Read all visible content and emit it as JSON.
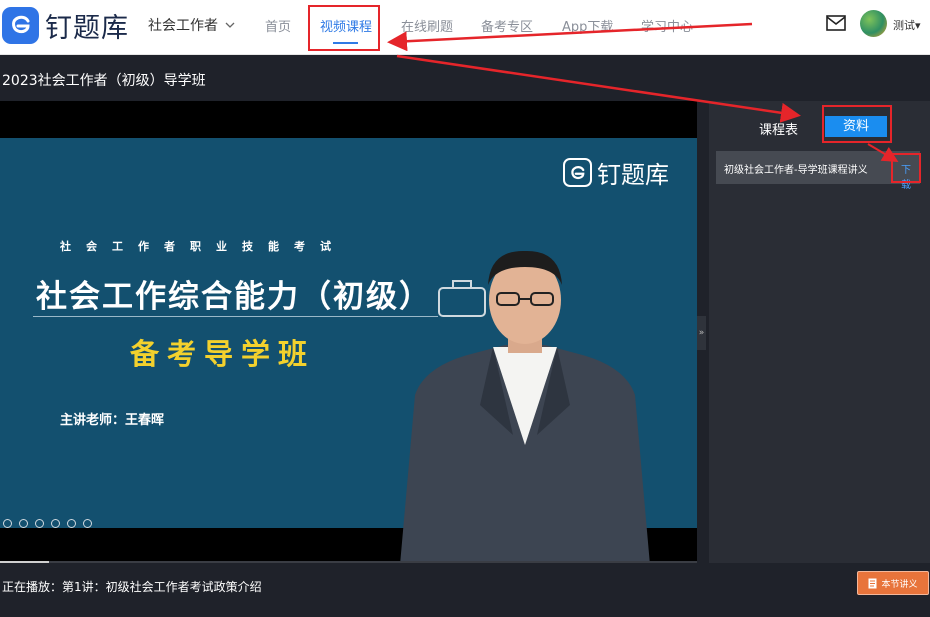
{
  "header": {
    "logo_text": "钉题库",
    "exam_selector": "社会工作者",
    "nav": [
      {
        "label": "首页",
        "active": false
      },
      {
        "label": "视频课程",
        "active": true
      },
      {
        "label": "在线刷题",
        "active": false
      },
      {
        "label": "备考专区",
        "active": false
      },
      {
        "label": "App下载",
        "active": false
      },
      {
        "label": "学习中心",
        "active": false
      }
    ],
    "username": "测试▾"
  },
  "course": {
    "title": "2023社会工作者（初级）导学班"
  },
  "slide": {
    "logo_text": "钉题库",
    "subtitle": "社会工作者职业技能考试",
    "heading": "社会工作综合能力（初级）",
    "class_name": "备考导学班",
    "teacher": "主讲老师：王春晖"
  },
  "player": {
    "progress": 0.07
  },
  "sidebar": {
    "tab_schedule": "课程表",
    "tab_materials": "资料",
    "materials": [
      {
        "name": "初级社会工作者-导学班课程讲义",
        "action": "下载"
      }
    ],
    "handle_glyph": "»"
  },
  "status": {
    "now_playing": "正在播放：第1讲：初级社会工作者考试政策介绍",
    "notes_button": "本节讲义"
  },
  "colors": {
    "accent": "#1a8df0",
    "annotation": "#e5252a",
    "notes_button": "#e8743b"
  }
}
